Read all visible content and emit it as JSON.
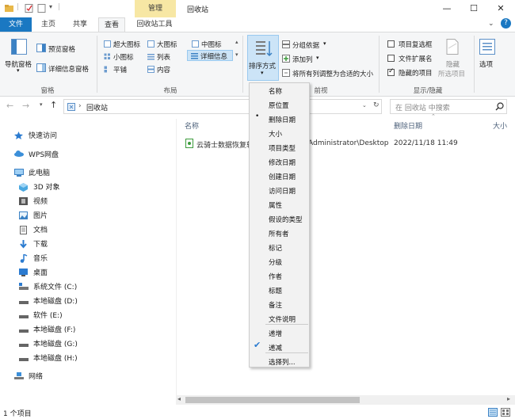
{
  "window": {
    "title": "回收站",
    "manage_tab": "管理",
    "minimize": "—",
    "maximize": "☐",
    "close": "✕",
    "help": "?",
    "collapse": "⌄"
  },
  "tabs": [
    "文件",
    "主页",
    "共享",
    "查看",
    "回收站工具"
  ],
  "ribbon": {
    "panes": {
      "nav_pane": "导航窗格",
      "preview_pane": "预览窗格",
      "details_pane": "详细信息窗格",
      "label": "窗格"
    },
    "layout": {
      "extra_large": "超大图标",
      "large": "大图标",
      "medium": "中图标",
      "small": "小图标",
      "list": "列表",
      "details": "详细信息",
      "tiles": "平铺",
      "content": "内容",
      "label": "布局"
    },
    "current_view": {
      "sort_by": "排序方式",
      "group_by": "分组依据",
      "add_columns": "添加列",
      "size_columns": "将所有列调整为合适的大小",
      "label_suffix": "前视图"
    },
    "show_hide": {
      "item_checkboxes": "项目复选框",
      "file_extensions": "文件扩展名",
      "hidden_items": "隐藏的项目",
      "hide": "隐藏",
      "hide_sub": "所选项目",
      "options": "选项",
      "label": "显示/隐藏"
    }
  },
  "address": {
    "path": "回收站",
    "search_placeholder": "在 回收站 中搜索"
  },
  "nav": {
    "quick_access": "快速访问",
    "wps": "WPS网盘",
    "this_pc": "此电脑",
    "items": [
      "3D 对象",
      "视频",
      "图片",
      "文档",
      "下载",
      "音乐",
      "桌面",
      "系统文件 (C:)",
      "本地磁盘 (D:)",
      "软件 (E:)",
      "本地磁盘 (F:)",
      "本地磁盘 (G:)",
      "本地磁盘 (H:)"
    ],
    "network": "网络"
  },
  "columns": {
    "name": "名称",
    "deleted_date": "删除日期",
    "size": "大小"
  },
  "file": {
    "name": "云骑士数据恢复软",
    "original_location": "Administrator\\Desktop",
    "deleted_date": "2022/11/18 11:49"
  },
  "sort_menu": {
    "items": [
      "名称",
      "原位置",
      "删除日期",
      "大小",
      "项目类型",
      "修改日期",
      "创建日期",
      "访问日期",
      "属性",
      "假设的类型",
      "所有者",
      "标记",
      "分级",
      "作者",
      "标题",
      "备注",
      "文件说明"
    ],
    "ascending": "递增",
    "descending": "递减",
    "choose_columns": "选择列..."
  },
  "status": {
    "count": "1 个项目"
  },
  "colors": {
    "accent": "#1a78c2",
    "manage_tab": "#f7e7a4",
    "selected_button": "#cce4f7"
  }
}
